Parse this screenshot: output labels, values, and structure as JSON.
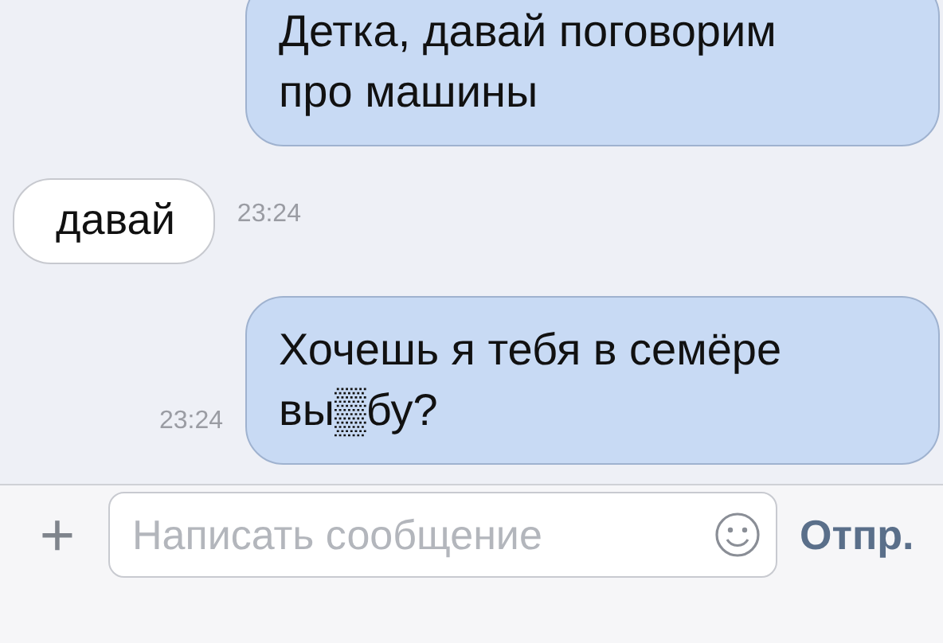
{
  "messages": [
    {
      "kind": "outgoing",
      "text": "Детка, давай поговорим про машины"
    },
    {
      "kind": "incoming",
      "text": "давай",
      "time": "23:24"
    },
    {
      "kind": "outgoing",
      "text": "Хочешь я тебя в семёре вы▒бу?",
      "time": "23:24"
    }
  ],
  "composer": {
    "add": "+",
    "placeholder": "Написать сообщение",
    "send": "Отпр."
  }
}
